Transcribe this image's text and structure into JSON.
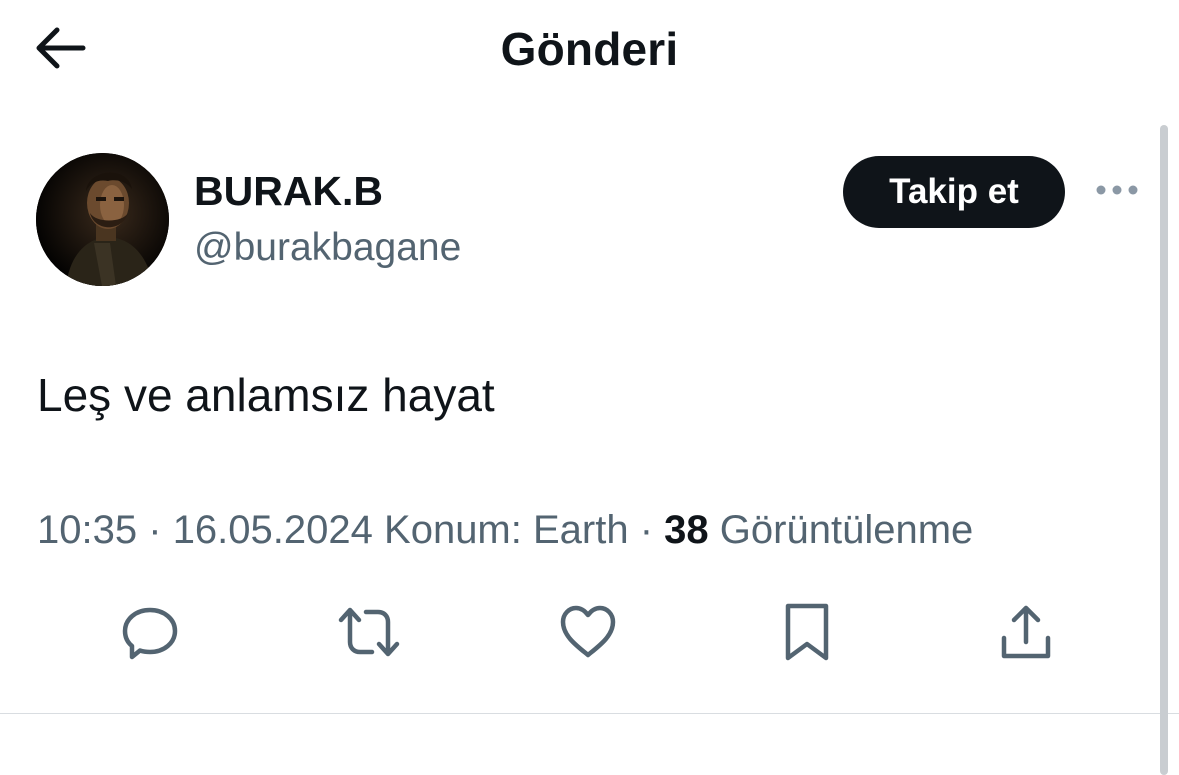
{
  "header": {
    "title": "Gönderi",
    "back_icon": "arrow-left-icon"
  },
  "author": {
    "display_name": "BURAK.B",
    "handle": "@burakbagane",
    "follow_label": "Takip et"
  },
  "tweet": {
    "text": "Leş ve anlamsız hayat",
    "time": "10:35",
    "date": "16.05.2024",
    "location": "Konum: Earth",
    "views_count": "38",
    "views_label": "Görüntülenme",
    "separator": "·"
  },
  "actions": [
    {
      "name": "reply",
      "icon": "reply-icon"
    },
    {
      "name": "retweet",
      "icon": "retweet-icon"
    },
    {
      "name": "like",
      "icon": "heart-icon"
    },
    {
      "name": "bookmark",
      "icon": "bookmark-icon"
    },
    {
      "name": "share",
      "icon": "share-icon"
    }
  ],
  "colors": {
    "text_primary": "#0f1419",
    "text_secondary": "#536471",
    "button_bg": "#0f1419",
    "button_text": "#ffffff",
    "divider": "#d9dde1"
  }
}
